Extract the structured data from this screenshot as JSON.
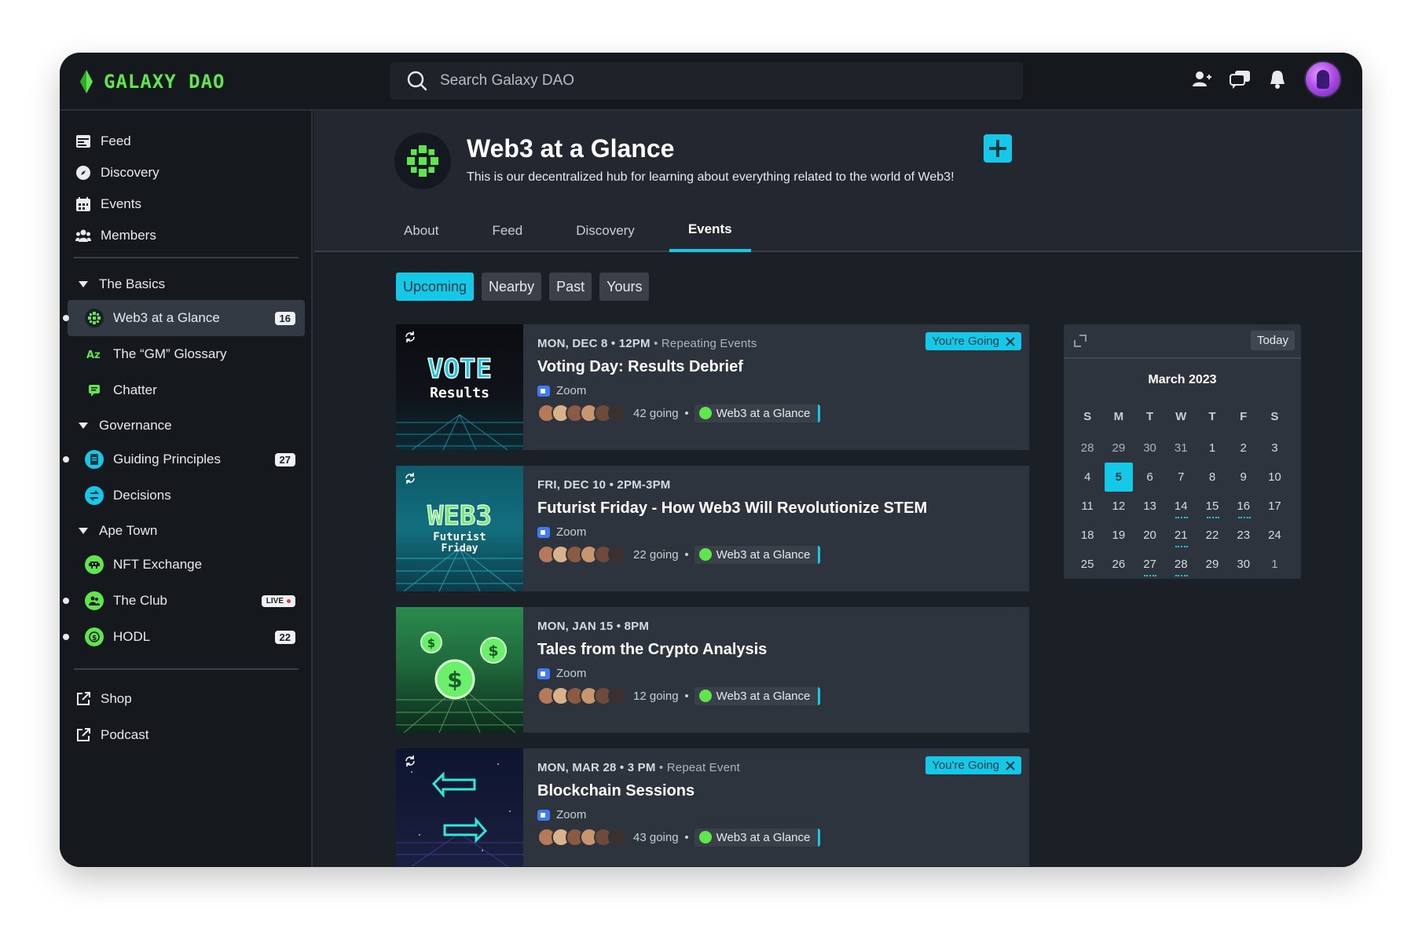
{
  "app": {
    "brand": "GALAXY DAO",
    "search_placeholder": "Search Galaxy DAO",
    "accent": "#14c9e8",
    "brand_color": "#5fe64a"
  },
  "sidebar": {
    "nav": [
      {
        "label": "Feed",
        "icon": "feed-icon"
      },
      {
        "label": "Discovery",
        "icon": "compass-icon"
      },
      {
        "label": "Events",
        "icon": "calendar-icon"
      },
      {
        "label": "Members",
        "icon": "members-icon"
      }
    ],
    "sections": [
      {
        "title": "The Basics",
        "items": [
          {
            "label": "Web3 at a Glance",
            "badge": "16",
            "active": true
          },
          {
            "label": "The “GM” Glossary"
          },
          {
            "label": "Chatter"
          }
        ]
      },
      {
        "title": "Governance",
        "items": [
          {
            "label": "Guiding Principles",
            "badge": "27"
          },
          {
            "label": "Decisions"
          }
        ]
      },
      {
        "title": "Ape Town",
        "items": [
          {
            "label": "NFT Exchange"
          },
          {
            "label": "The Club",
            "badge": "LIVE"
          },
          {
            "label": "HODL",
            "badge": "22"
          }
        ]
      }
    ],
    "links": [
      {
        "label": "Shop",
        "icon": "external-link-icon"
      },
      {
        "label": "Podcast",
        "icon": "external-link-icon"
      }
    ]
  },
  "hub": {
    "title": "Web3 at a Glance",
    "description": "This is our decentralized hub for learning about everything related to the world of Web3!",
    "tabs": [
      "About",
      "Feed",
      "Discovery",
      "Events"
    ],
    "active_tab": "Events"
  },
  "filters": [
    "Upcoming",
    "Nearby",
    "Past",
    "Yours"
  ],
  "active_filter": "Upcoming",
  "events": [
    {
      "date": "MON, DEC 8 • 12PM",
      "sub": "• Repeating Events",
      "title": "Voting Day: Results Debrief",
      "location": "Zoom",
      "going": "42 going",
      "hub": "Web3 at a Glance",
      "badge": "You're Going",
      "thumb_text": [
        "VOTE",
        "Results"
      ],
      "repeating": true
    },
    {
      "date": "FRI, DEC 10 • 2PM-3PM",
      "sub": "",
      "title": "Futurist Friday - How Web3 Will Revolutionize STEM",
      "location": "Zoom",
      "going": "22 going",
      "hub": "Web3 at a Glance",
      "badge": "",
      "thumb_text": [
        "WEB3",
        "Futurist",
        "Friday"
      ],
      "repeating": true
    },
    {
      "date": "MON, JAN 15  •  8PM",
      "sub": "",
      "title": "Tales from the Crypto Analysis",
      "location": "Zoom",
      "going": "12 going",
      "hub": "Web3 at a Glance",
      "badge": "",
      "thumb_text": [],
      "repeating": false
    },
    {
      "date": "MON, MAR 28 • 3 PM",
      "sub": "• Repeat Event",
      "title": "Blockchain Sessions",
      "location": "Zoom",
      "going": "43 going",
      "hub": "Web3 at a Glance",
      "badge": "You're Going",
      "thumb_text": [],
      "repeating": true
    }
  ],
  "calendar": {
    "today_label": "Today",
    "month": "March 2023",
    "weekdays": [
      "S",
      "M",
      "T",
      "W",
      "T",
      "F",
      "S"
    ],
    "weeks": [
      [
        "28",
        "29",
        "30",
        "31",
        "1",
        "2",
        "3"
      ],
      [
        "4",
        "5",
        "6",
        "7",
        "8",
        "9",
        "10"
      ],
      [
        "11",
        "12",
        "13",
        "14",
        "15",
        "16",
        "17"
      ],
      [
        "18",
        "19",
        "20",
        "21",
        "22",
        "23",
        "24"
      ],
      [
        "25",
        "26",
        "27",
        "28",
        "29",
        "30",
        "1"
      ]
    ],
    "selected": "5",
    "event_days": [
      "14",
      "15",
      "16",
      "21",
      "27",
      "28"
    ]
  }
}
